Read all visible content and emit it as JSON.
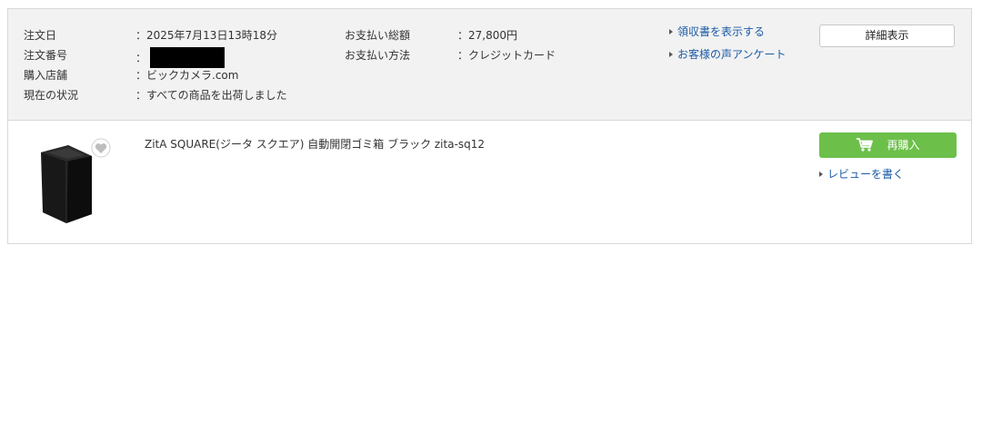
{
  "order": {
    "labels": {
      "order_date": "注文日",
      "order_number": "注文番号",
      "store": "購入店舗",
      "status": "現在の状況",
      "total": "お支払い総額",
      "payment_method": "お支払い方法"
    },
    "values": {
      "order_date": "：2025年7月13日13時18分",
      "order_number_prefix": "：",
      "store": "：ビックカメラ.com",
      "status": "：すべての商品を出荷しました",
      "total": "：27,800円",
      "payment_method": "：クレジットカード"
    },
    "links": {
      "receipt": "領収書を表示する",
      "survey": "お客様の声アンケート"
    },
    "detail_button": "詳細表示"
  },
  "item": {
    "name": "ZitA SQUARE(ジータ スクエア) 自動開閉ゴミ箱 ブラック zita-sq12",
    "rebuy_button": "再購入",
    "review_link": "レビューを書く",
    "image_icon": "trash-can-product-image",
    "favorite_icon": "heart-icon"
  },
  "colors": {
    "header_bg": "#f2f2f2",
    "link": "#1a5aa6",
    "rebuy": "#6cc04a"
  }
}
